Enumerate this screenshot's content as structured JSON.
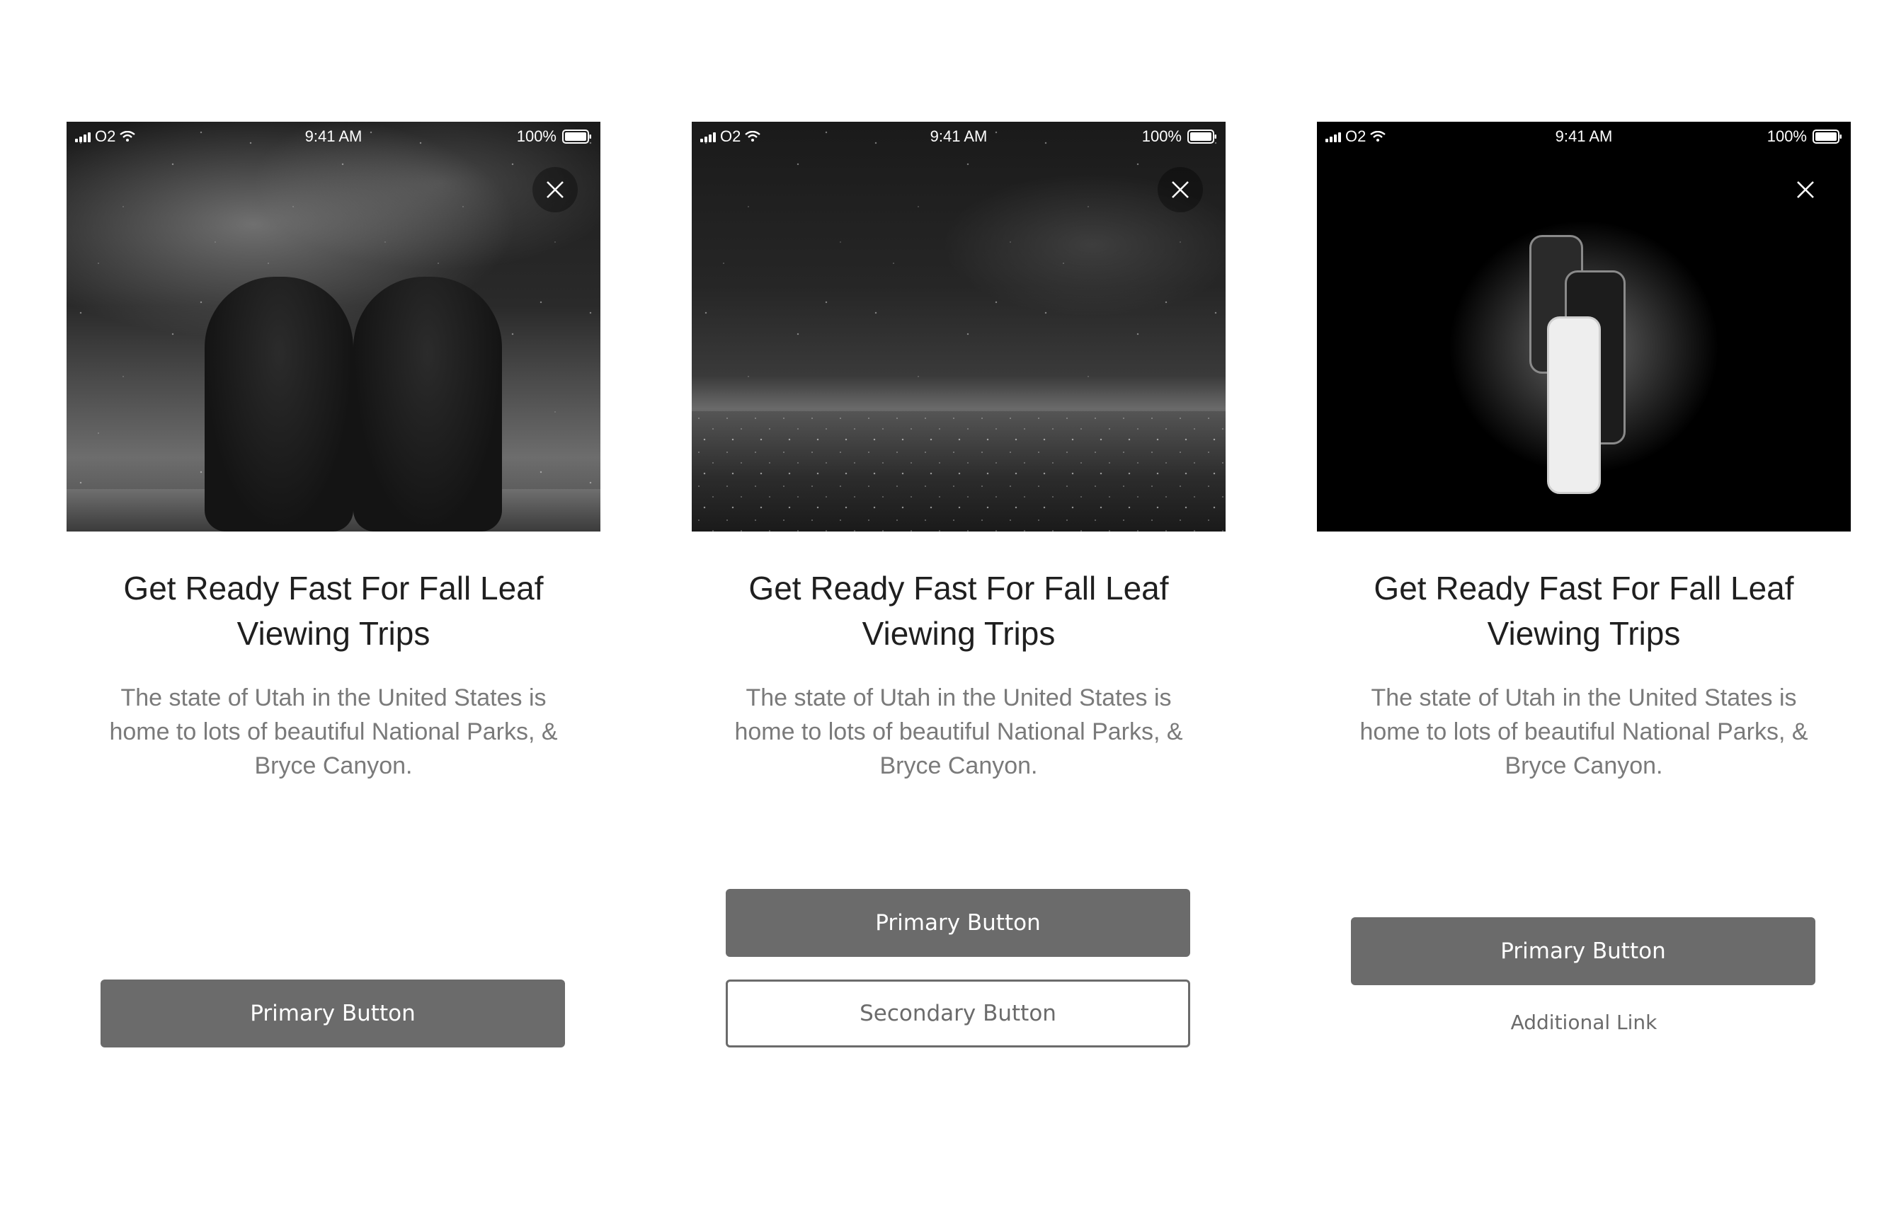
{
  "status_bar": {
    "carrier": "O2",
    "time": "9:41 AM",
    "battery": "100%",
    "icons": [
      "signal-icon",
      "wifi-icon",
      "battery-icon"
    ]
  },
  "close_icon": "close-icon",
  "cards": [
    {
      "hero_image": "two-bearded-men-starry-sky",
      "title": "Get Ready Fast For Fall Leaf Viewing Trips",
      "description": "The state of Utah in the United States is home to lots of beautiful National Parks, & Bryce Canyon.",
      "primary_label": "Primary Button"
    },
    {
      "hero_image": "city-lights-night-sky",
      "title": "Get Ready Fast For Fall Leaf Viewing Trips",
      "description": "The state of Utah in the United States is home to lots of beautiful National Parks, & Bryce Canyon.",
      "primary_label": "Primary Button",
      "secondary_label": "Secondary Button"
    },
    {
      "hero_image": "smartphones-powder-burst",
      "title": "Get Ready Fast For Fall Leaf Viewing Trips",
      "description": "The state of Utah in the United States is home to lots of beautiful National Parks, & Bryce Canyon.",
      "primary_label": "Primary Button",
      "link_label": "Additional Link"
    }
  ],
  "colors": {
    "button_fill": "#6b6b6b",
    "title_text": "#1f1f1f",
    "body_text": "#7a7a7a"
  }
}
